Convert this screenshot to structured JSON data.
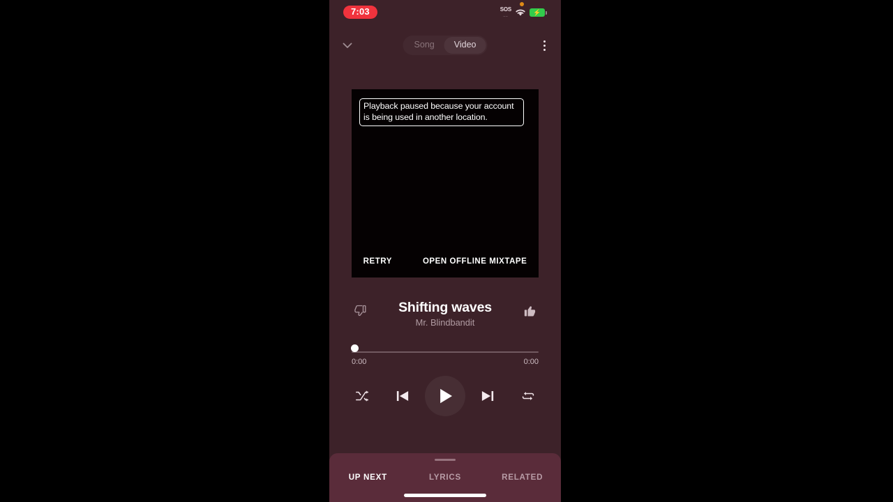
{
  "status_bar": {
    "time": "7:03",
    "time_pill_color": "#f0333d",
    "sos_label": "SOS",
    "icons": [
      "orange-dot-icon",
      "sos-icon",
      "wifi-icon",
      "battery-charging-icon"
    ],
    "battery_color": "#32cb4b"
  },
  "player_header": {
    "collapse_icon": "chevron-down-icon",
    "overflow_icon": "more-vertical-icon",
    "modes": [
      {
        "label": "Song",
        "active": false
      },
      {
        "label": "Video",
        "active": true
      }
    ]
  },
  "video_area": {
    "background_color": "#050102",
    "error_message": "Playback paused because your account is being used in another location.",
    "actions": [
      {
        "label": "RETRY"
      },
      {
        "label": "OPEN OFFLINE MIXTAPE"
      }
    ]
  },
  "track": {
    "title": "Shifting waves",
    "artist": "Mr. Blindbandit",
    "dislike_icon": "thumbs-down-icon",
    "like_icon": "thumbs-up-icon"
  },
  "progress": {
    "elapsed": "0:00",
    "total": "0:00",
    "percent": 0
  },
  "controls": {
    "shuffle": "shuffle-icon",
    "previous": "skip-previous-icon",
    "play": "play-icon",
    "next": "skip-next-icon",
    "repeat": "repeat-icon"
  },
  "bottom_sheet": {
    "background_color": "#5a2c3a",
    "tabs": [
      {
        "label": "UP NEXT",
        "active": true
      },
      {
        "label": "LYRICS",
        "active": false
      },
      {
        "label": "RELATED",
        "active": false
      }
    ]
  }
}
